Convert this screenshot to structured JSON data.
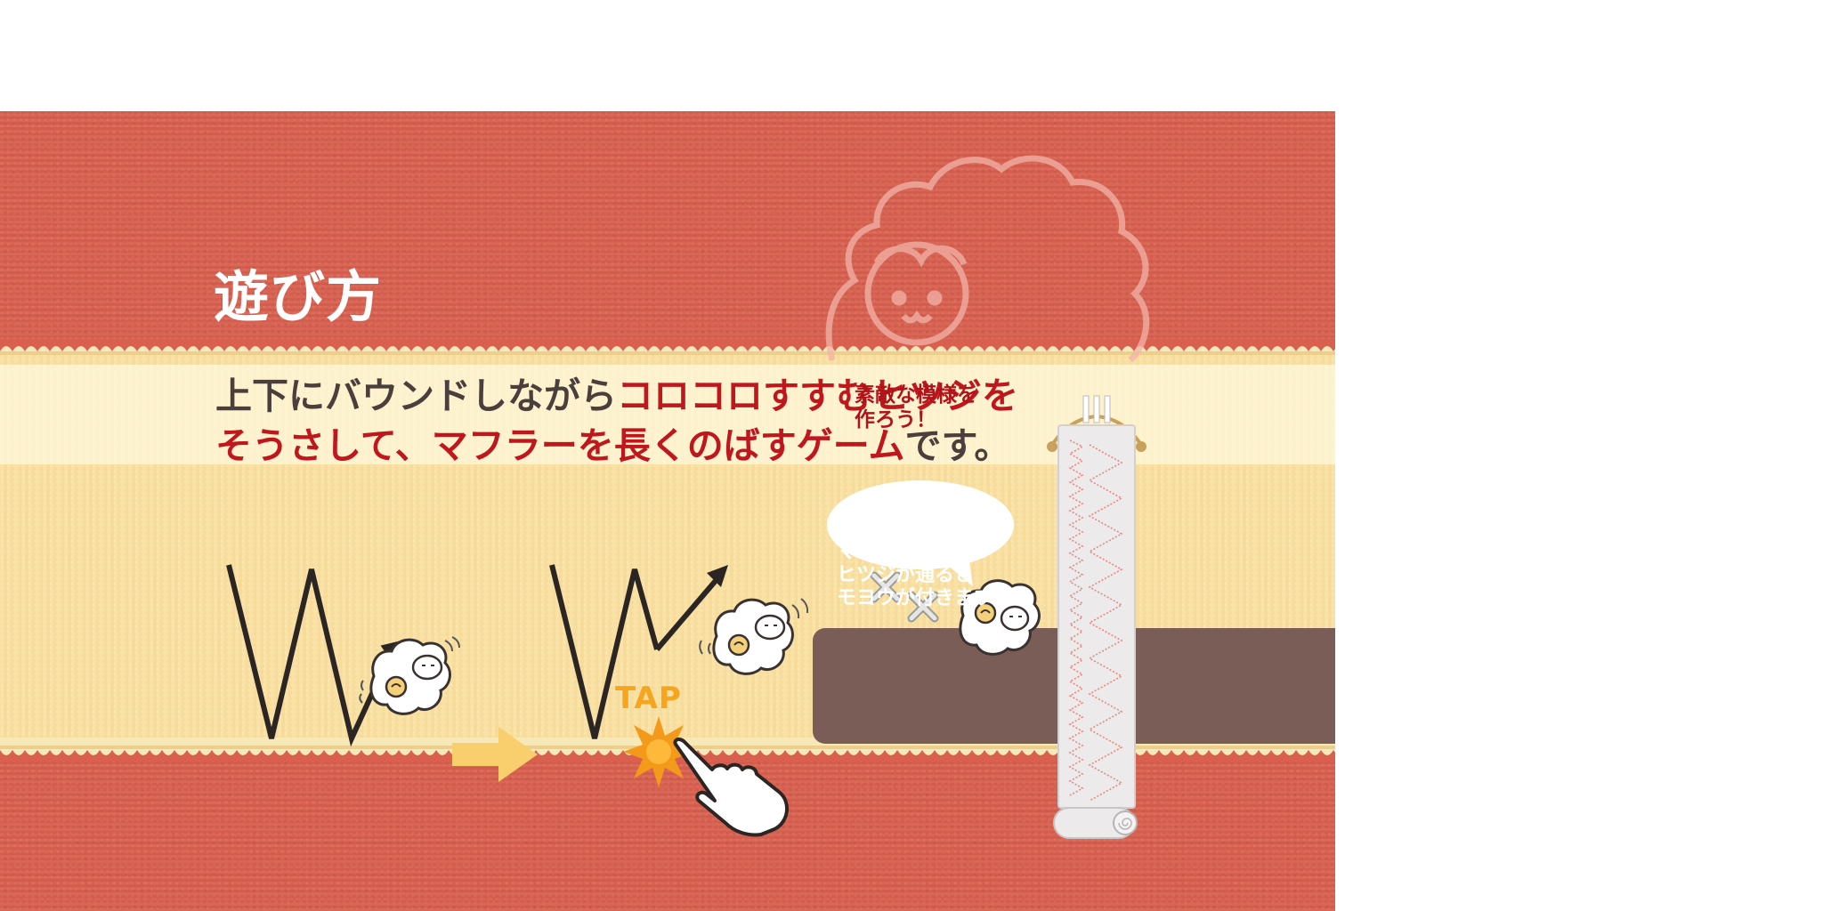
{
  "title": "遊び方",
  "headline": {
    "line1_normal": "上下にバウンドしながら",
    "line1_highlight": "コロコロすすむヒツジを",
    "line2_highlight": "そうさして、マフラーを長くのばすゲーム",
    "line2_normal": "です。"
  },
  "step2": {
    "tap_label": "TAP"
  },
  "speech_bubble": "素敵な模様を\n作ろう！",
  "info_box": "マフラーには、\nヒツジが通ると\nモヨウが付きます。",
  "colors": {
    "red_band": "#d9604f",
    "cream_band": "#f9df9e",
    "highlight_text": "#c0171e",
    "body_text": "#4a3f3c",
    "tap_orange": "#f7a51e",
    "info_box": "#7a5d57"
  },
  "icons": [
    "sheep-outline-icon",
    "sheep-icon",
    "zigzag-path-icon",
    "arrow-right-icon",
    "tap-burst-icon",
    "pointing-hand-icon",
    "x-mark-icon",
    "scarf-scroll-icon"
  ]
}
